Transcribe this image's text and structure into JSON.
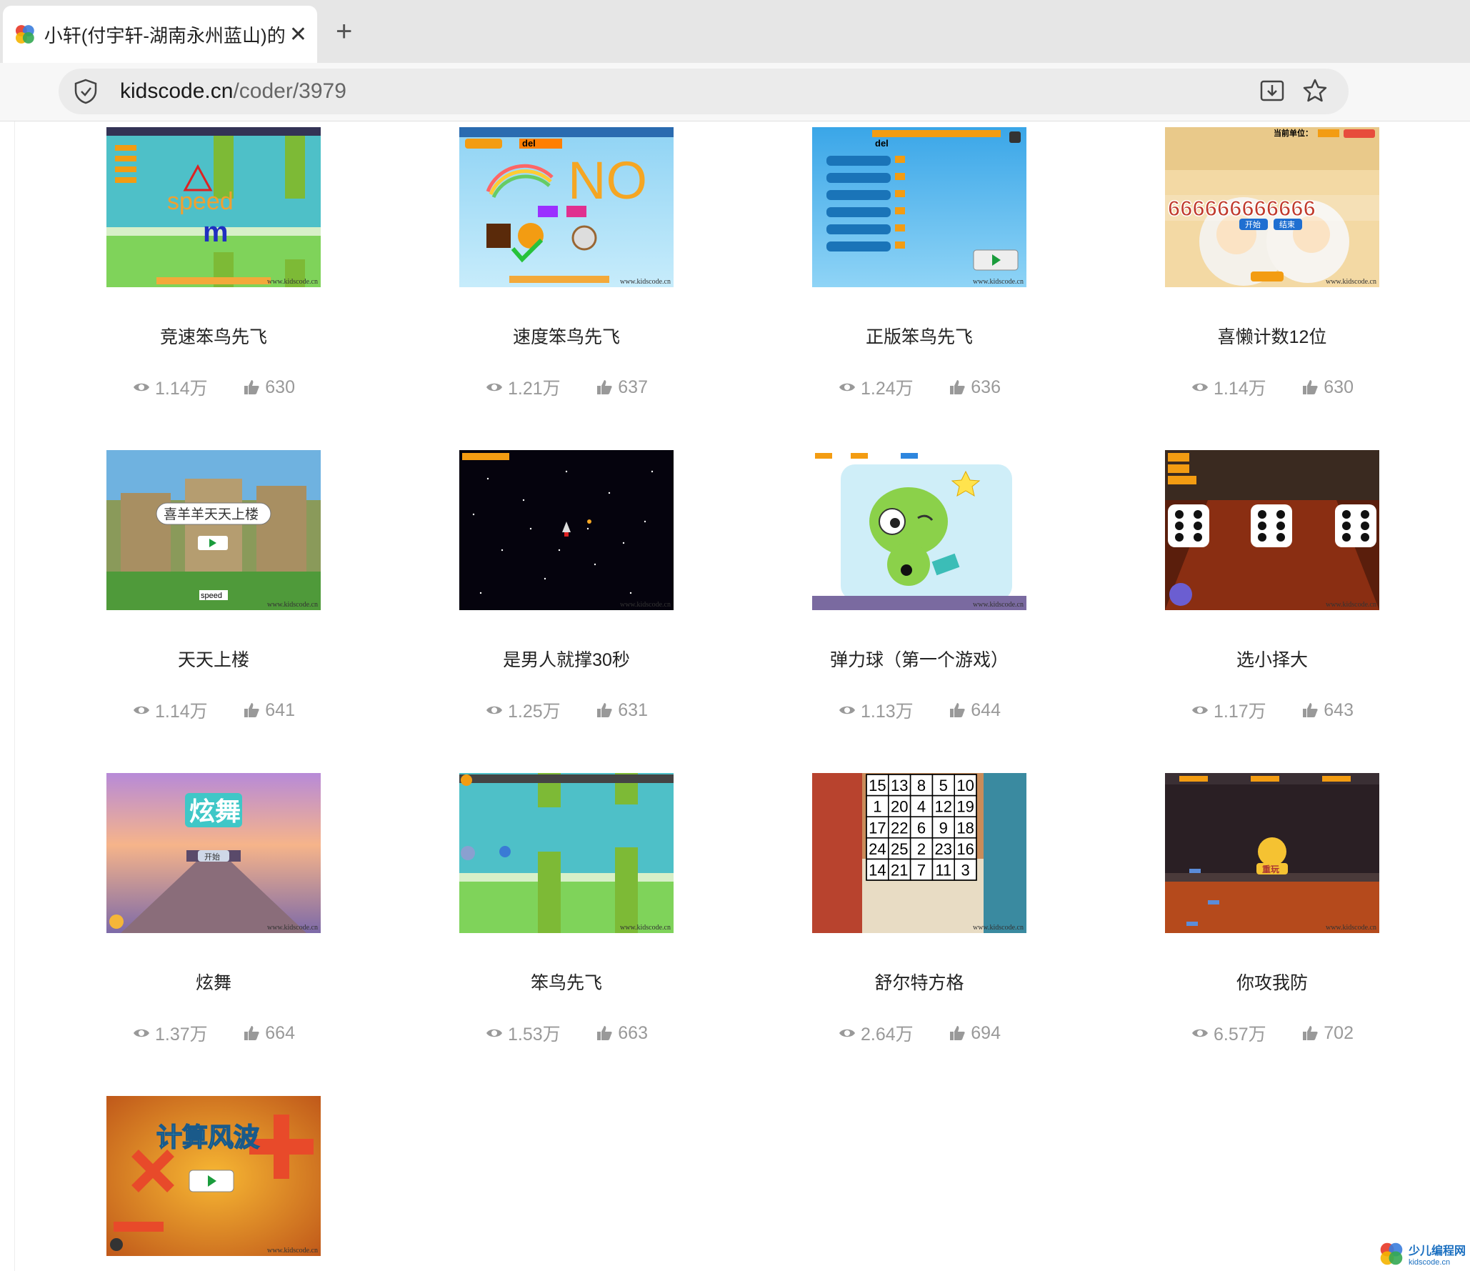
{
  "browser": {
    "tab_title": "小轩(付宇轩-湖南永州蓝山)的个",
    "close_glyph": "✕",
    "newtab_glyph": "+",
    "url_host": "kidscode.cn",
    "url_path": "/coder/3979"
  },
  "cards": [
    {
      "title": "竞速笨鸟先飞",
      "views": "1.14万",
      "likes": "630"
    },
    {
      "title": "速度笨鸟先飞",
      "views": "1.21万",
      "likes": "637"
    },
    {
      "title": "正版笨鸟先飞",
      "views": "1.24万",
      "likes": "636"
    },
    {
      "title": "喜懒计数12位",
      "views": "1.14万",
      "likes": "630"
    },
    {
      "title": "天天上楼",
      "views": "1.14万",
      "likes": "641"
    },
    {
      "title": "是男人就撑30秒",
      "views": "1.25万",
      "likes": "631"
    },
    {
      "title": "弹力球（第一个游戏）",
      "views": "1.13万",
      "likes": "644"
    },
    {
      "title": "选小择大",
      "views": "1.17万",
      "likes": "643"
    },
    {
      "title": "炫舞",
      "views": "1.37万",
      "likes": "664"
    },
    {
      "title": "笨鸟先飞",
      "views": "1.53万",
      "likes": "663"
    },
    {
      "title": "舒尔特方格",
      "views": "2.64万",
      "likes": "694"
    },
    {
      "title": "你攻我防",
      "views": "6.57万",
      "likes": "702"
    },
    {
      "title": "",
      "views": "",
      "likes": ""
    }
  ],
  "thumb_text": {
    "t1_speed": "speed",
    "t1_m": "m",
    "t2_no": "NO",
    "t2_del": "del",
    "t3_del": "del",
    "t4_digits": "666666666666",
    "t4_unit": "当前单位：",
    "t4_start": "开始",
    "t4_end": "结束",
    "t5_sign": "喜羊羊天天上楼",
    "t5_speed": "speed",
    "t9_title": "炫舞",
    "t9_start": "开始",
    "t12_replay": "重玩",
    "t13_title": "计算风波",
    "watermark": "www.kidscode.cn"
  },
  "schulte_grid": [
    [
      "15",
      "13",
      "8",
      "5",
      "10"
    ],
    [
      "1",
      "20",
      "4",
      "12",
      "19"
    ],
    [
      "17",
      "22",
      "6",
      "9",
      "18"
    ],
    [
      "24",
      "25",
      "2",
      "23",
      "16"
    ],
    [
      "14",
      "21",
      "7",
      "11",
      "3"
    ]
  ],
  "corner_logo": {
    "name": "少儿编程网",
    "domain": "kidscode.cn"
  }
}
